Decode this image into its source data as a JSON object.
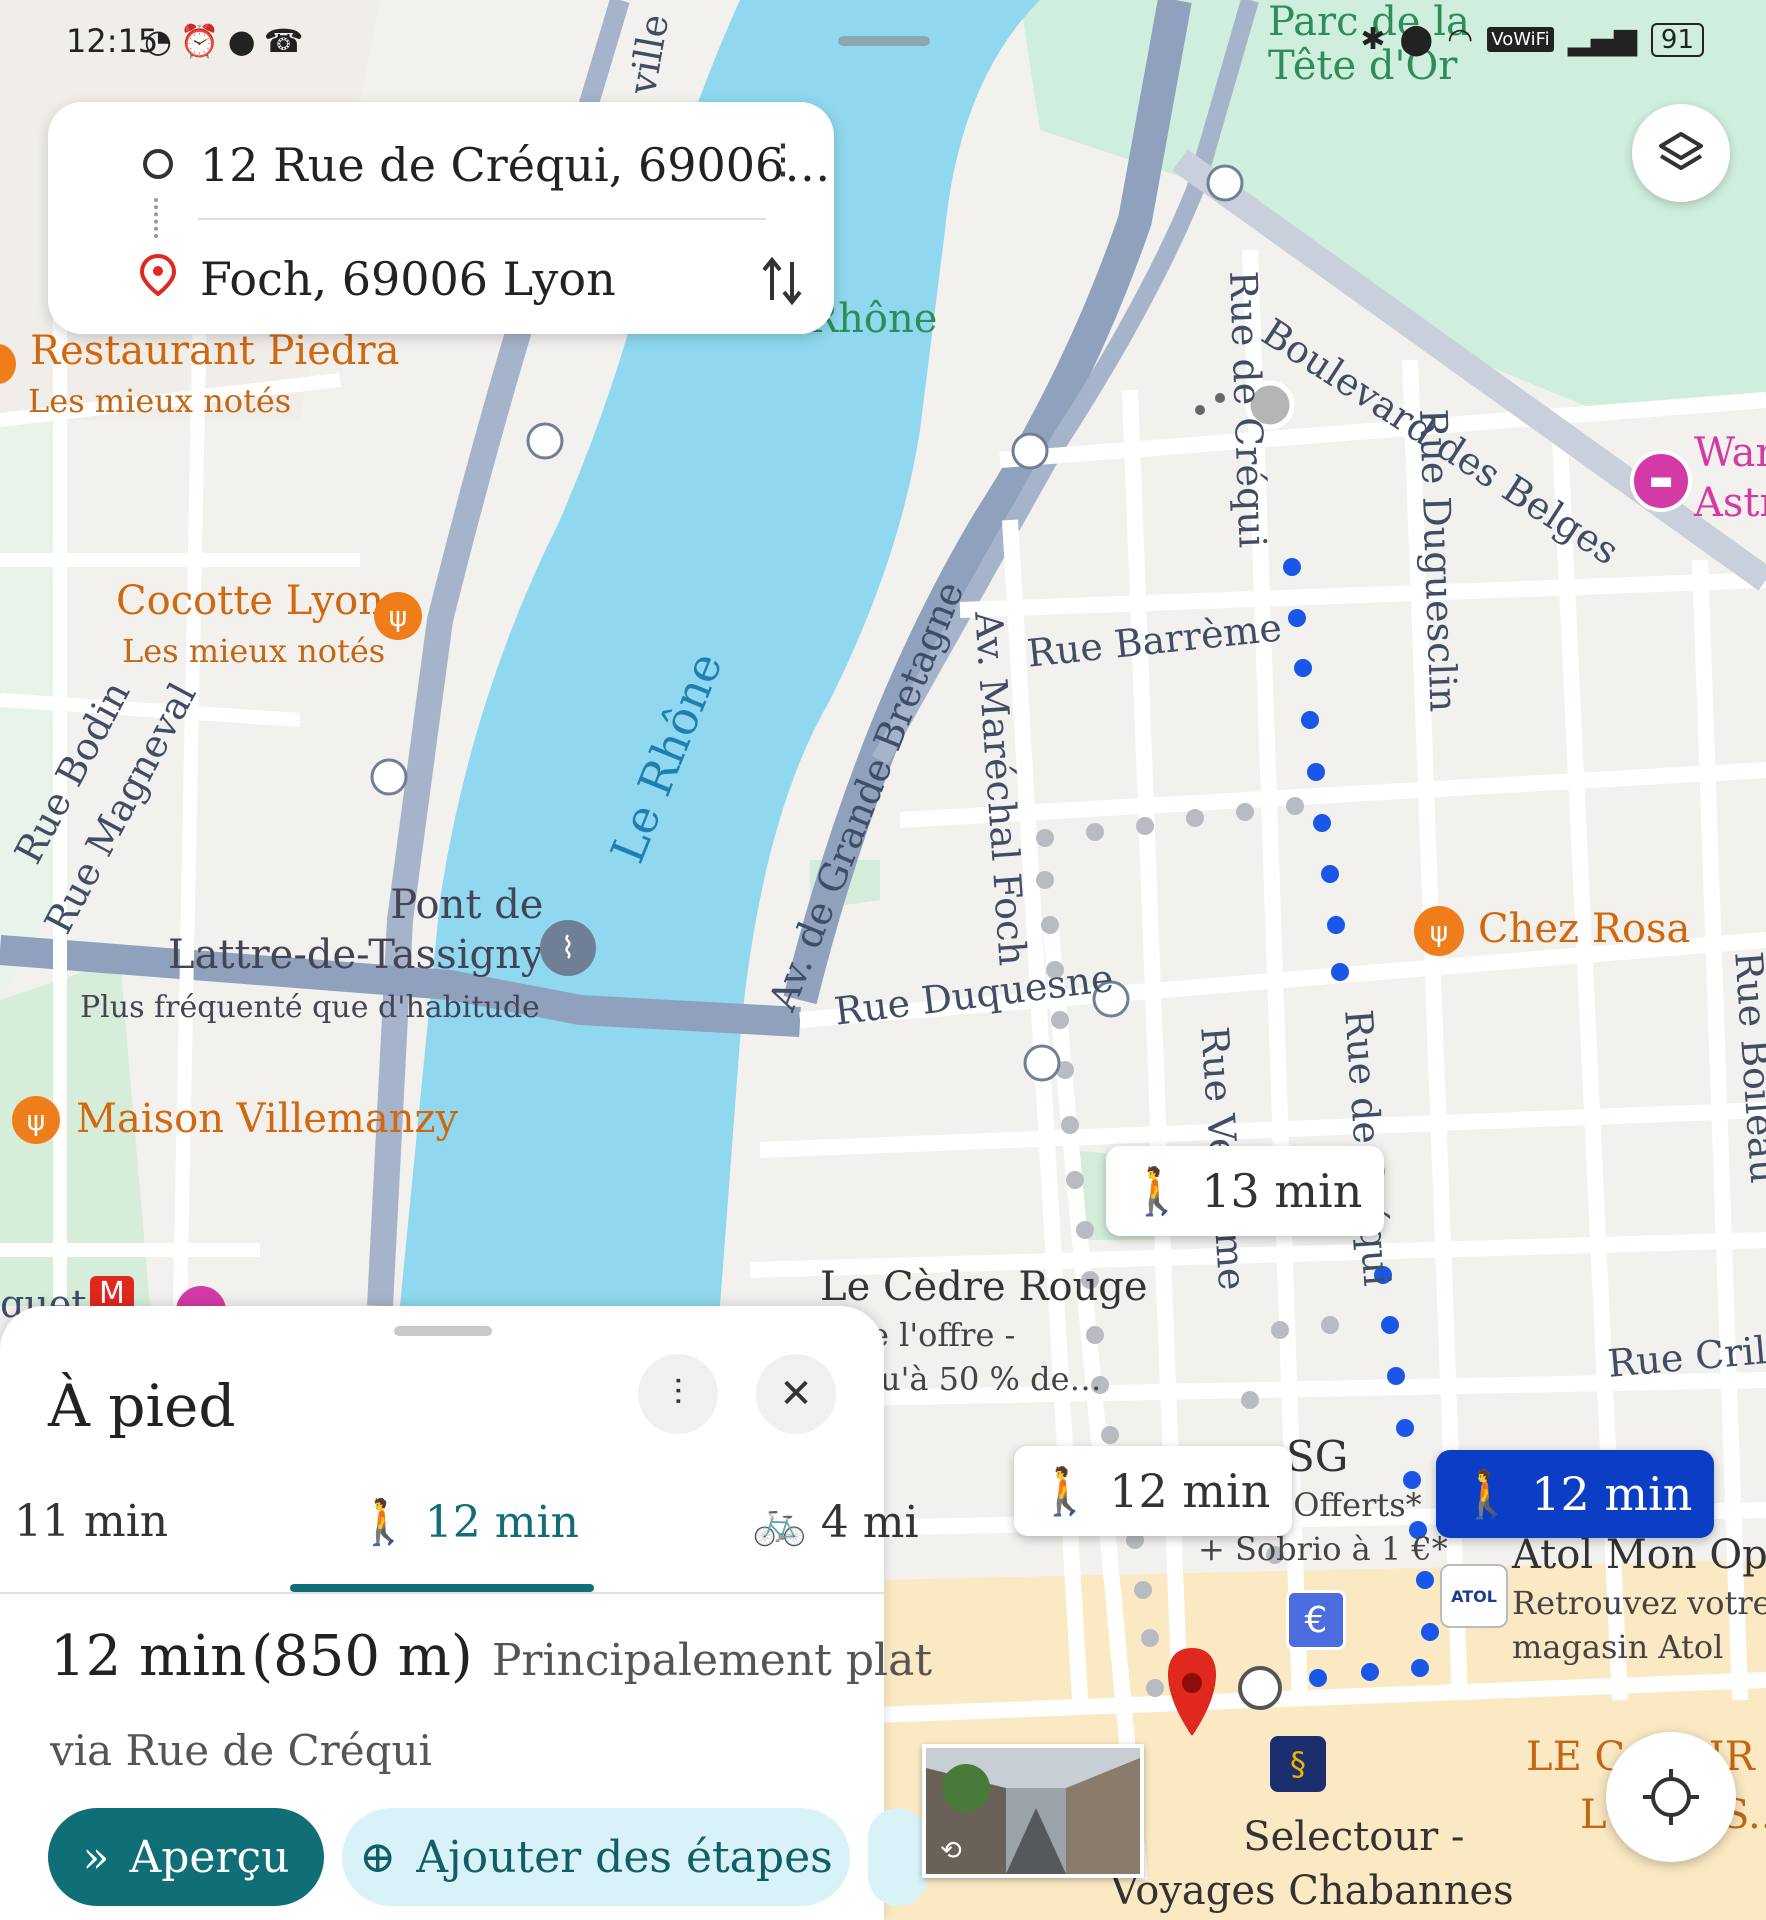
{
  "status_bar": {
    "time": "12:15",
    "left_icons": [
      "speedometer-icon",
      "alarm-icon",
      "chat-icon",
      "missed-call-icon"
    ],
    "right_icons": [
      "bluetooth-icon",
      "location-icon",
      "wifi-icon",
      "signal-icon"
    ],
    "vowifi": "VoWiFi",
    "battery": "91"
  },
  "search": {
    "origin": "12 Rue de Créqui, 69006…",
    "destination": "Foch, 69006 Lyon"
  },
  "map": {
    "streets": {
      "boulevard_belges": "Boulevard des Belges",
      "rue_crequi_top": "Rue de Créqui",
      "rue_crequi_bottom": "Rue de Créqui",
      "rue_duguesclin": "Rue Duguesclin",
      "rue_barreme": "Rue Barrème",
      "av_grande_bretagne": "Av. de Grande Bretagne",
      "av_marechal_foch": "Av. Maréchal Foch",
      "rue_duquesne": "Rue Duquesne",
      "rue_vendome": "Rue Vendôme",
      "rue_crillon": "Rue Crillon",
      "rue_boileau": "Rue Boileau",
      "rue_bodin": "Rue Bodin",
      "rue_magneval": "Rue Magneval",
      "ville_top": "ville",
      "quet_left": "quet"
    },
    "river": "Le Rhône",
    "rhone_partial": "Rhône",
    "parc": [
      "Parc de la",
      "Tête d'Or"
    ],
    "pont": {
      "name": [
        "Pont de",
        "Lattre-de-Tassigny"
      ],
      "note": "Plus fréquenté que d'habitude"
    },
    "pois": {
      "piedra": {
        "name": "Restaurant Piedra",
        "sub": "Les mieux notés"
      },
      "cocotte": {
        "name": "Cocotte Lyon",
        "sub": "Les mieux notés"
      },
      "villemanzy": {
        "name": "Maison Villemanzy"
      },
      "chez_rosa": {
        "name": "Chez Rosa"
      },
      "cedre": {
        "name": "Le Cèdre Rouge",
        "line1": "e l'offre -",
        "line2": "u'à 50 % de…"
      },
      "sg": {
        "name": "SG",
        "line1": ") € Offerts*",
        "line2": "+ Sobrio à 1 €*"
      },
      "atol": {
        "name": "Atol Mon Opti",
        "line1": "Retrouvez votre",
        "line2": "magasin Atol",
        "logo": "ATOL"
      },
      "selectour": {
        "name": [
          "Selectour -",
          "Voyages Chabannes"
        ]
      },
      "wanda": {
        "name": [
          "Wan",
          "Astr"
        ]
      },
      "le_comptoir": {
        "name": [
          "LE C",
          "L",
          "OIR",
          "S.."
        ]
      }
    },
    "route_bubbles": {
      "alt1": "13 min",
      "alt2": "12 min",
      "selected": "12 min"
    },
    "metro_label": "M"
  },
  "sheet": {
    "title": "À pied",
    "tabs": [
      {
        "label": "11 min",
        "icon": "car-icon"
      },
      {
        "label": "12 min",
        "icon": "walk-icon"
      },
      {
        "label": "4 mi",
        "icon": "bike-icon"
      }
    ],
    "summary_time": "12 min",
    "summary_distance": "(850 m)",
    "summary_terrain": "Principalement plat",
    "via": "via Rue de Créqui",
    "preview_button": "Aperçu",
    "add_stops_button": "Ajouter des étapes"
  },
  "colors": {
    "route_blue": "#1a56e8",
    "alt_route_gray": "#b8bcc2",
    "river": "#8fd8ef",
    "park": "#cfeedd",
    "highway": "#8fa1bd",
    "accent_teal": "#0f6e76",
    "poi_orange": "#ef7d1a",
    "pin_red": "#e0281e",
    "selected_bubble": "#0b3ec5"
  }
}
